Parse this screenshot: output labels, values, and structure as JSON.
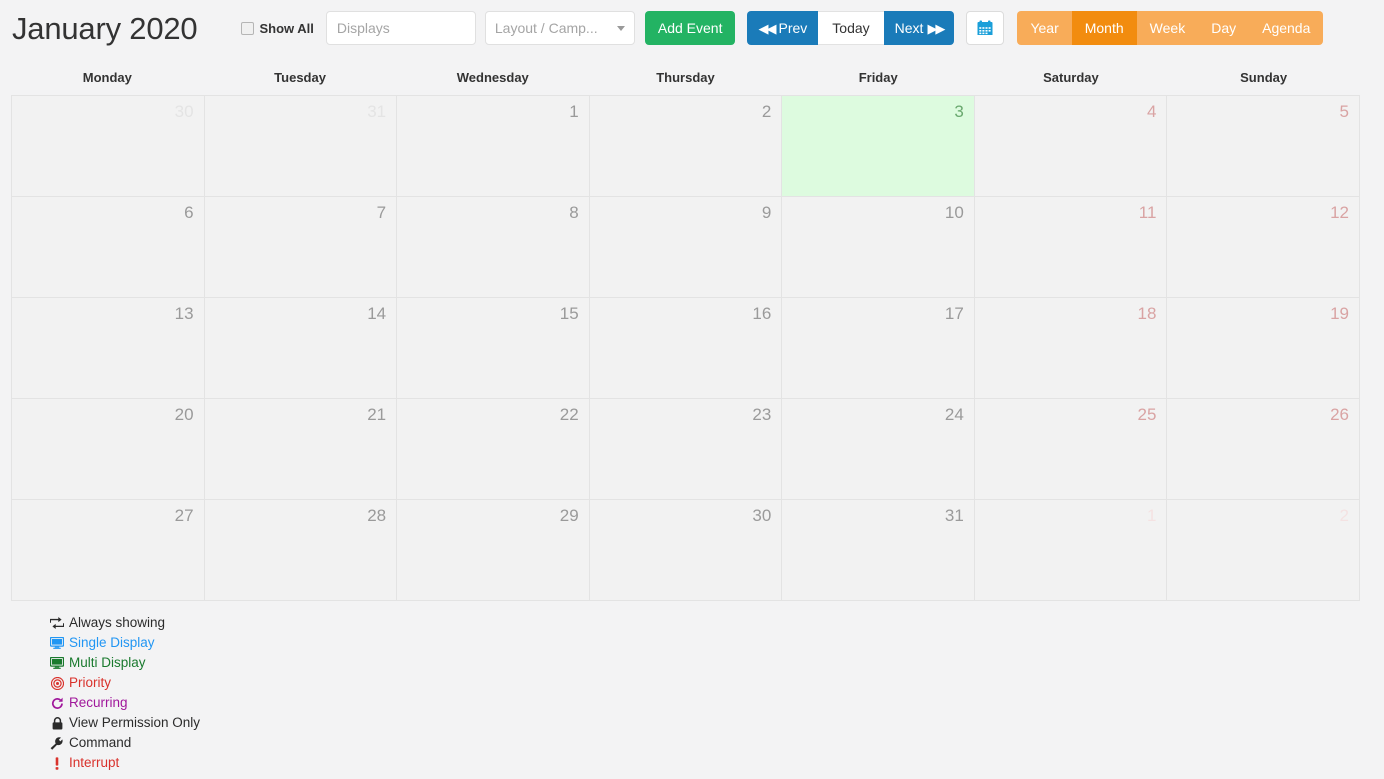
{
  "header": {
    "title": "January 2020",
    "show_all_label": "Show All",
    "show_all_checked": false,
    "displays_placeholder": "Displays",
    "displays_value": "",
    "layout_select_value": "Layout / Camp...",
    "add_event_label": "Add Event",
    "prev_label": "Prev",
    "today_label": "Today",
    "next_label": "Next",
    "calendar_icon": "calendar-icon",
    "views": [
      {
        "label": "Year",
        "active": false
      },
      {
        "label": "Month",
        "active": true
      },
      {
        "label": "Week",
        "active": false
      },
      {
        "label": "Day",
        "active": false
      },
      {
        "label": "Agenda",
        "active": false
      }
    ]
  },
  "colors": {
    "add_event": "#23b363",
    "nav": "#1a7bb9",
    "view": "#f8ac59",
    "view_active": "#f28c0f",
    "today_bg": "#ddfbdf",
    "today_number": "#6aa96f",
    "weekend_number": "#d9a3a3",
    "day_number": "#9a9a9a",
    "grid_border": "#e3e3e3",
    "cell_bg": "#f2f2f2",
    "page_bg": "#f3f3f4"
  },
  "calendar": {
    "weekdays": [
      "Monday",
      "Tuesday",
      "Wednesday",
      "Thursday",
      "Friday",
      "Saturday",
      "Sunday"
    ],
    "weeks": [
      [
        {
          "day": 30,
          "other": true,
          "weekend": false,
          "today": false
        },
        {
          "day": 31,
          "other": true,
          "weekend": false,
          "today": false
        },
        {
          "day": 1,
          "other": false,
          "weekend": false,
          "today": false
        },
        {
          "day": 2,
          "other": false,
          "weekend": false,
          "today": false
        },
        {
          "day": 3,
          "other": false,
          "weekend": false,
          "today": true
        },
        {
          "day": 4,
          "other": false,
          "weekend": true,
          "today": false
        },
        {
          "day": 5,
          "other": false,
          "weekend": true,
          "today": false
        }
      ],
      [
        {
          "day": 6,
          "other": false,
          "weekend": false,
          "today": false
        },
        {
          "day": 7,
          "other": false,
          "weekend": false,
          "today": false
        },
        {
          "day": 8,
          "other": false,
          "weekend": false,
          "today": false
        },
        {
          "day": 9,
          "other": false,
          "weekend": false,
          "today": false
        },
        {
          "day": 10,
          "other": false,
          "weekend": false,
          "today": false
        },
        {
          "day": 11,
          "other": false,
          "weekend": true,
          "today": false
        },
        {
          "day": 12,
          "other": false,
          "weekend": true,
          "today": false
        }
      ],
      [
        {
          "day": 13,
          "other": false,
          "weekend": false,
          "today": false
        },
        {
          "day": 14,
          "other": false,
          "weekend": false,
          "today": false
        },
        {
          "day": 15,
          "other": false,
          "weekend": false,
          "today": false
        },
        {
          "day": 16,
          "other": false,
          "weekend": false,
          "today": false
        },
        {
          "day": 17,
          "other": false,
          "weekend": false,
          "today": false
        },
        {
          "day": 18,
          "other": false,
          "weekend": true,
          "today": false
        },
        {
          "day": 19,
          "other": false,
          "weekend": true,
          "today": false
        }
      ],
      [
        {
          "day": 20,
          "other": false,
          "weekend": false,
          "today": false
        },
        {
          "day": 21,
          "other": false,
          "weekend": false,
          "today": false
        },
        {
          "day": 22,
          "other": false,
          "weekend": false,
          "today": false
        },
        {
          "day": 23,
          "other": false,
          "weekend": false,
          "today": false
        },
        {
          "day": 24,
          "other": false,
          "weekend": false,
          "today": false
        },
        {
          "day": 25,
          "other": false,
          "weekend": true,
          "today": false
        },
        {
          "day": 26,
          "other": false,
          "weekend": true,
          "today": false
        }
      ],
      [
        {
          "day": 27,
          "other": false,
          "weekend": false,
          "today": false
        },
        {
          "day": 28,
          "other": false,
          "weekend": false,
          "today": false
        },
        {
          "day": 29,
          "other": false,
          "weekend": false,
          "today": false
        },
        {
          "day": 30,
          "other": false,
          "weekend": false,
          "today": false
        },
        {
          "day": 31,
          "other": false,
          "weekend": false,
          "today": false
        },
        {
          "day": 1,
          "other": true,
          "weekend": true,
          "today": false
        },
        {
          "day": 2,
          "other": true,
          "weekend": true,
          "today": false
        }
      ]
    ]
  },
  "legend": [
    {
      "label": "Always showing",
      "icon": "retweet-icon",
      "color": "#2b2b2b"
    },
    {
      "label": "Single Display",
      "icon": "monitor-icon",
      "color": "#2196f3"
    },
    {
      "label": "Multi Display",
      "icon": "monitor-icon",
      "color": "#1a7a2e"
    },
    {
      "label": "Priority",
      "icon": "bullseye-icon",
      "color": "#d9322c"
    },
    {
      "label": "Recurring",
      "icon": "refresh-icon",
      "color": "#a0189b"
    },
    {
      "label": "View Permission Only",
      "icon": "lock-icon",
      "color": "#2b2b2b"
    },
    {
      "label": "Command",
      "icon": "wrench-icon",
      "color": "#2b2b2b"
    },
    {
      "label": "Interrupt",
      "icon": "exclamation-icon",
      "color": "#d9322c"
    }
  ]
}
